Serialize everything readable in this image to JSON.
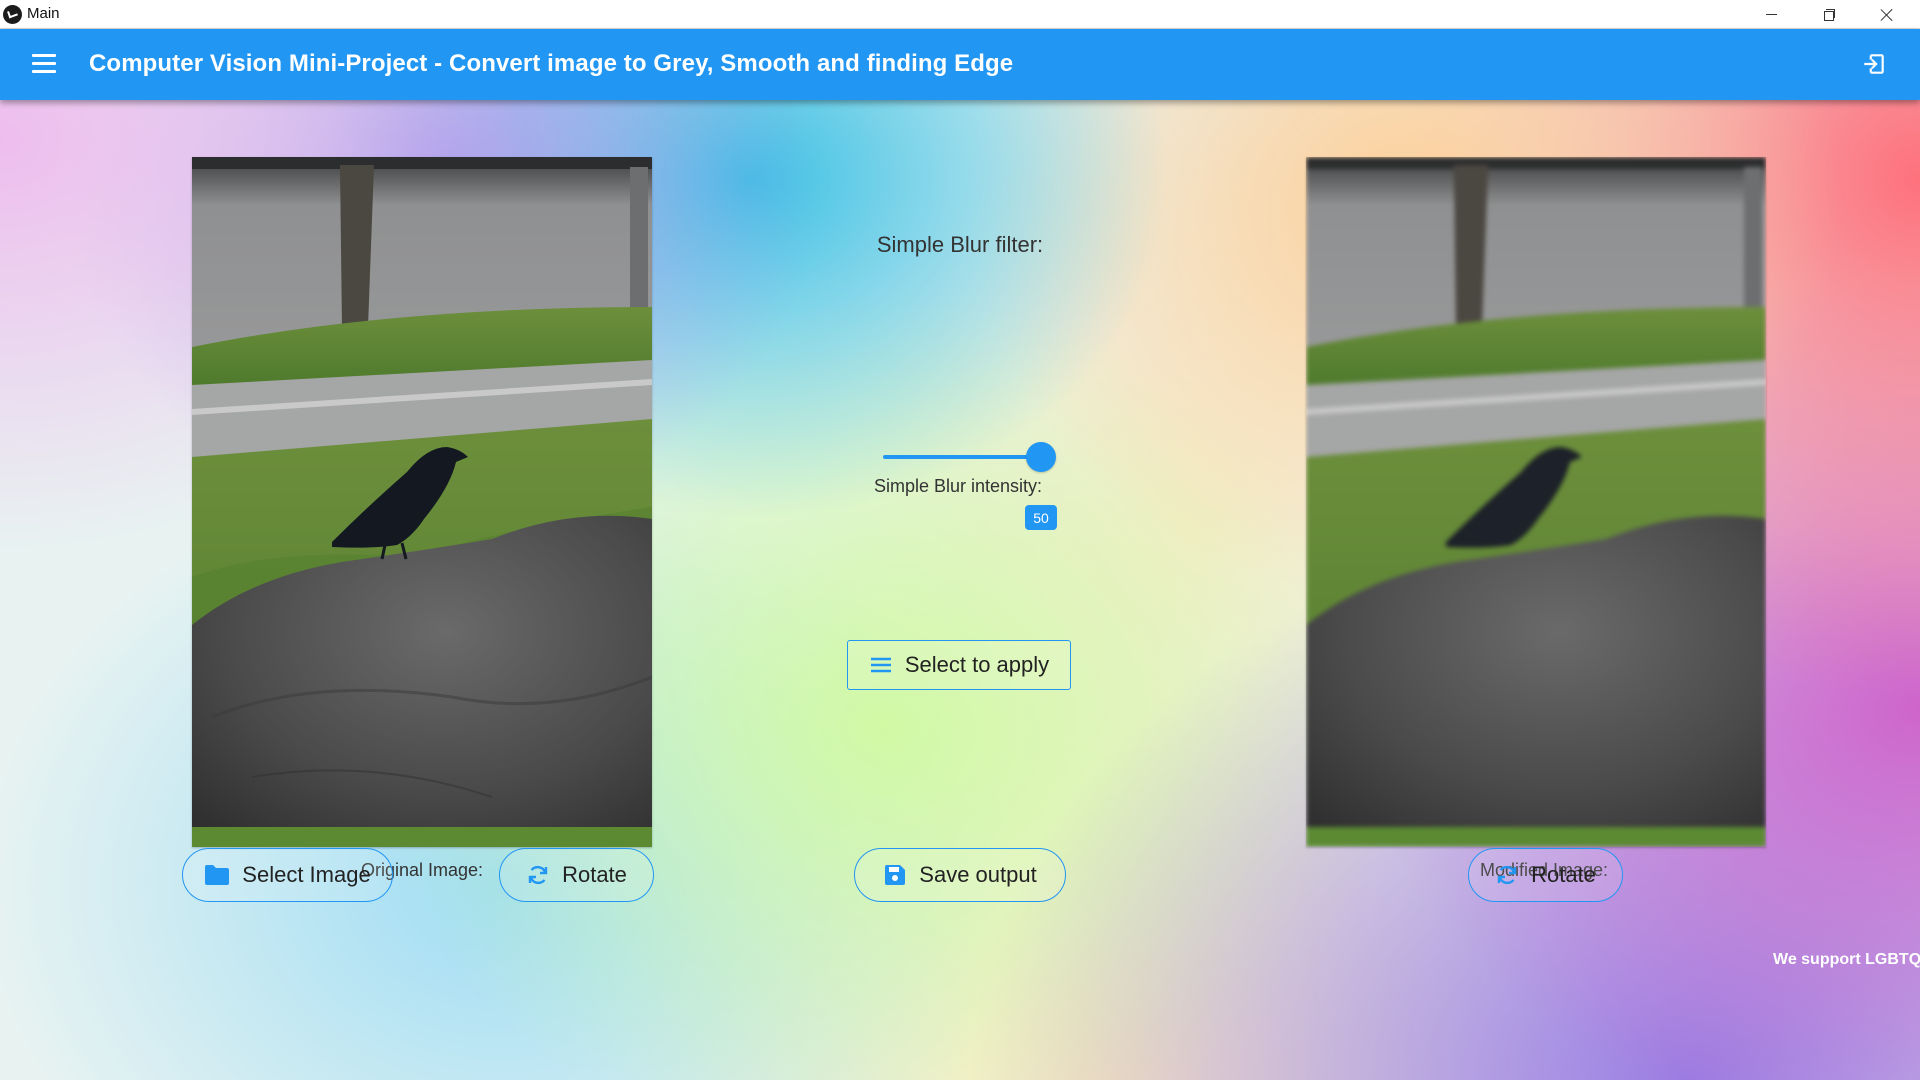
{
  "window": {
    "title": "Main"
  },
  "appbar": {
    "title": "Computer Vision Mini-Project - Convert image to Grey, Smooth and finding Edge",
    "color": "#2196f3"
  },
  "images": {
    "original_caption": "Original Image:",
    "modified_caption": "Modified Image:"
  },
  "filter": {
    "label": "Simple Blur filter:",
    "intensity_label": "Simple Blur intensity:",
    "intensity_value": "50",
    "apply_label": "Select to apply"
  },
  "buttons": {
    "select_image": "Select Image",
    "rotate_original": "Rotate",
    "save_output": "Save output",
    "rotate_modified": "Rotate"
  },
  "icons": {
    "app": "app-logo-icon",
    "menu": "hamburger-menu-icon",
    "logout": "exit-icon",
    "apply": "list-icon",
    "select_image": "folder-icon",
    "rotate": "rotate-icon",
    "save": "floppy-disk-icon"
  },
  "footer": {
    "banner": "We support LGBTQ+"
  }
}
